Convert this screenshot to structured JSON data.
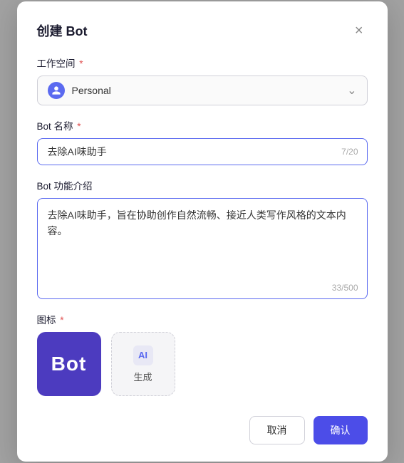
{
  "dialog": {
    "title": "创建 Bot",
    "close_label": "×"
  },
  "workspace_field": {
    "label": "工作空间",
    "required": true,
    "value": "Personal"
  },
  "bot_name_field": {
    "label": "Bot 名称",
    "required": true,
    "value": "去除AI味助手",
    "char_count": "7/20"
  },
  "bot_desc_field": {
    "label": "Bot 功能介绍",
    "required": false,
    "value": "去除AI味助手，旨在协助创作自然流畅、接近人类写作风格的文本内容。",
    "char_count": "33/500"
  },
  "icon_section": {
    "label": "图标",
    "required": true,
    "selected_icon_text": "Bot",
    "generate_label": "生成",
    "ai_label": "AI"
  },
  "footer": {
    "cancel_label": "取消",
    "confirm_label": "确认"
  }
}
